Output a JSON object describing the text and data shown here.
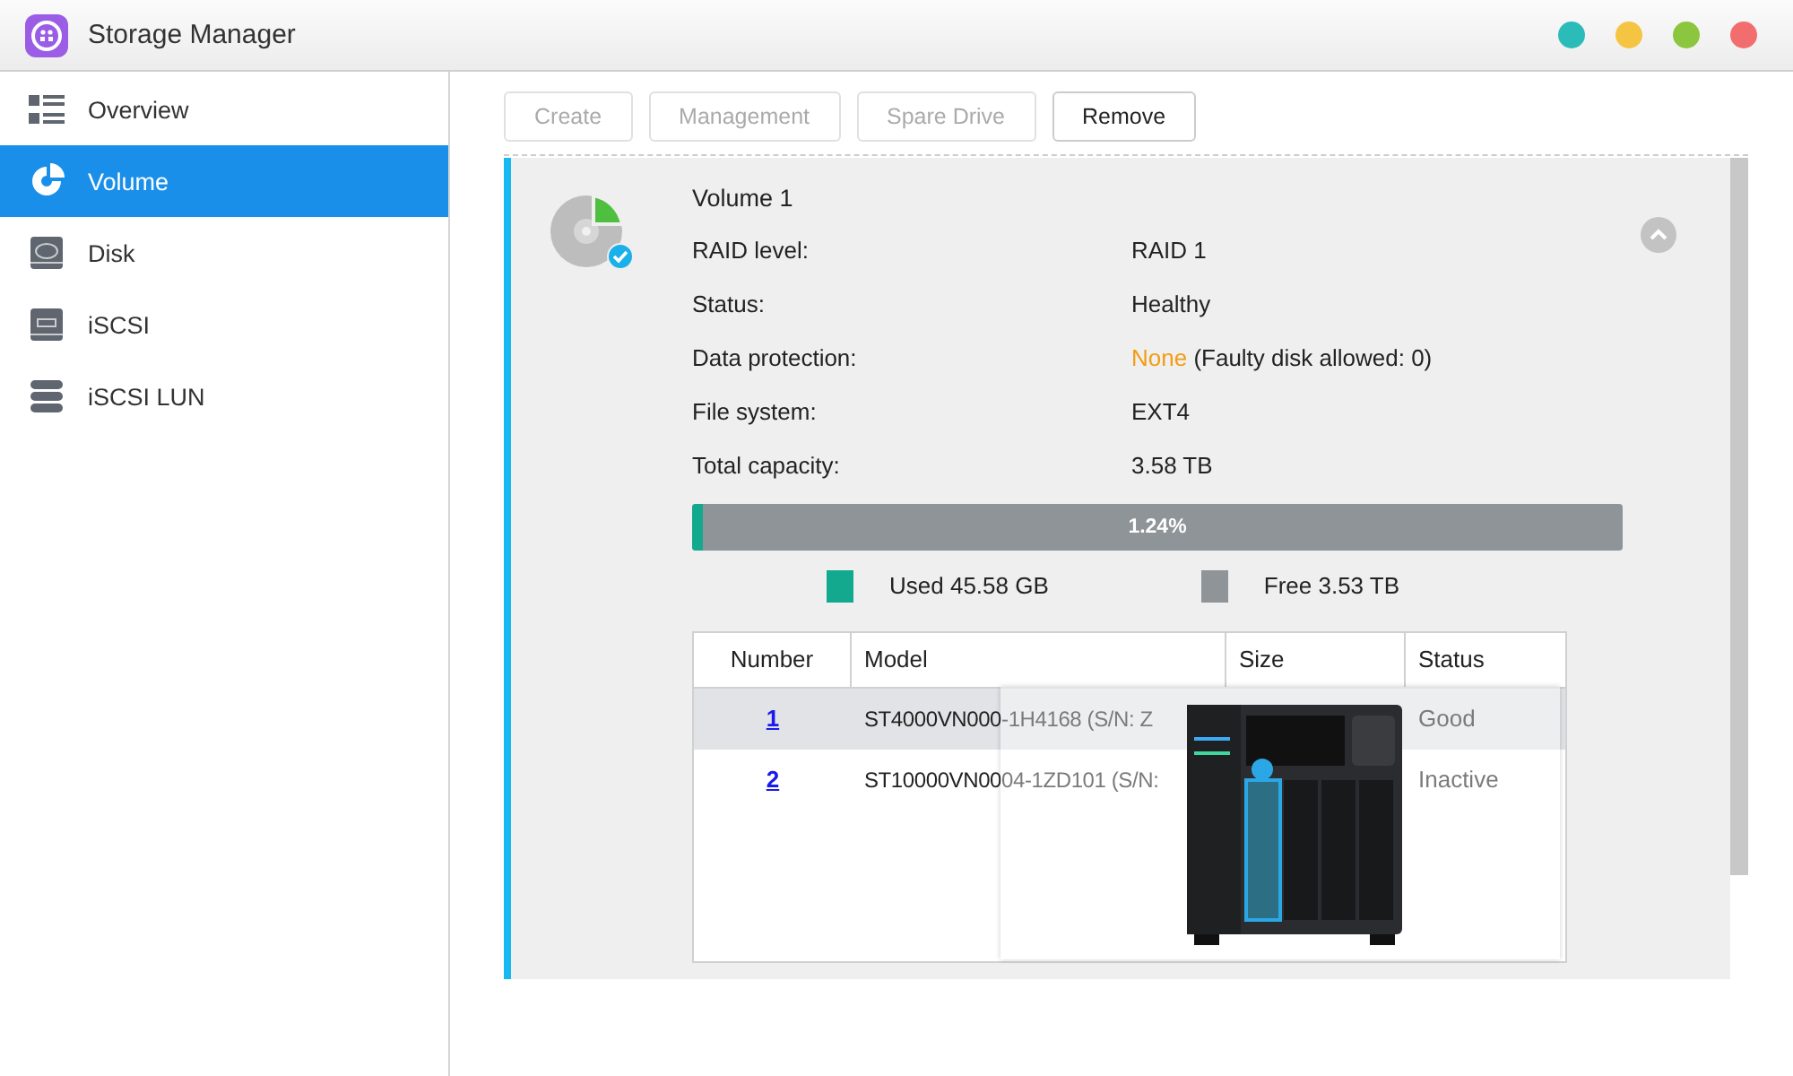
{
  "window": {
    "title": "Storage Manager",
    "controls": [
      {
        "color": "#2bbcb9"
      },
      {
        "color": "#f6c443"
      },
      {
        "color": "#8cc63f"
      },
      {
        "color": "#f26d6d"
      }
    ]
  },
  "sidebar": {
    "items": [
      {
        "label": "Overview",
        "kind": "overview",
        "selected": false
      },
      {
        "label": "Volume",
        "kind": "volume",
        "selected": true
      },
      {
        "label": "Disk",
        "kind": "disk",
        "selected": false
      },
      {
        "label": "iSCSI",
        "kind": "iscsi",
        "selected": false
      },
      {
        "label": "iSCSI LUN",
        "kind": "lun",
        "selected": false
      }
    ]
  },
  "toolbar": {
    "buttons": [
      {
        "label": "Create",
        "disabled": true
      },
      {
        "label": "Management",
        "disabled": true
      },
      {
        "label": "Spare Drive",
        "disabled": true
      },
      {
        "label": "Remove",
        "disabled": false
      }
    ]
  },
  "volume": {
    "title": "Volume 1",
    "expanded": true,
    "fields": [
      {
        "label": "RAID level:",
        "value": "RAID 1",
        "highlight": false
      },
      {
        "label": "Status:",
        "value": "Healthy",
        "highlight": false
      },
      {
        "label": "Data protection:",
        "value": "None",
        "note": "(Faulty disk allowed: 0)",
        "highlight": true
      },
      {
        "label": "File system:",
        "value": "EXT4",
        "highlight": false
      },
      {
        "label": "Total capacity:",
        "value": "3.58 TB",
        "highlight": false
      }
    ],
    "usage": {
      "level": 0.0124,
      "label": "1.24%"
    },
    "legend": [
      {
        "label": "Used 45.58 GB",
        "color": "#12a98f"
      },
      {
        "label": "Free 3.53 TB",
        "color": "#8e9497"
      }
    ],
    "disks": {
      "columns": [
        "Number",
        "Model",
        "Size",
        "Status"
      ],
      "rows": [
        {
          "number": "1",
          "model": "ST4000VN000-1H4168 (S/N: Z",
          "status": "Good",
          "selected": true
        },
        {
          "number": "2",
          "model": "ST10000VN0004-1ZD101 (S/N:",
          "status": "Inactive",
          "selected": false
        }
      ]
    }
  }
}
